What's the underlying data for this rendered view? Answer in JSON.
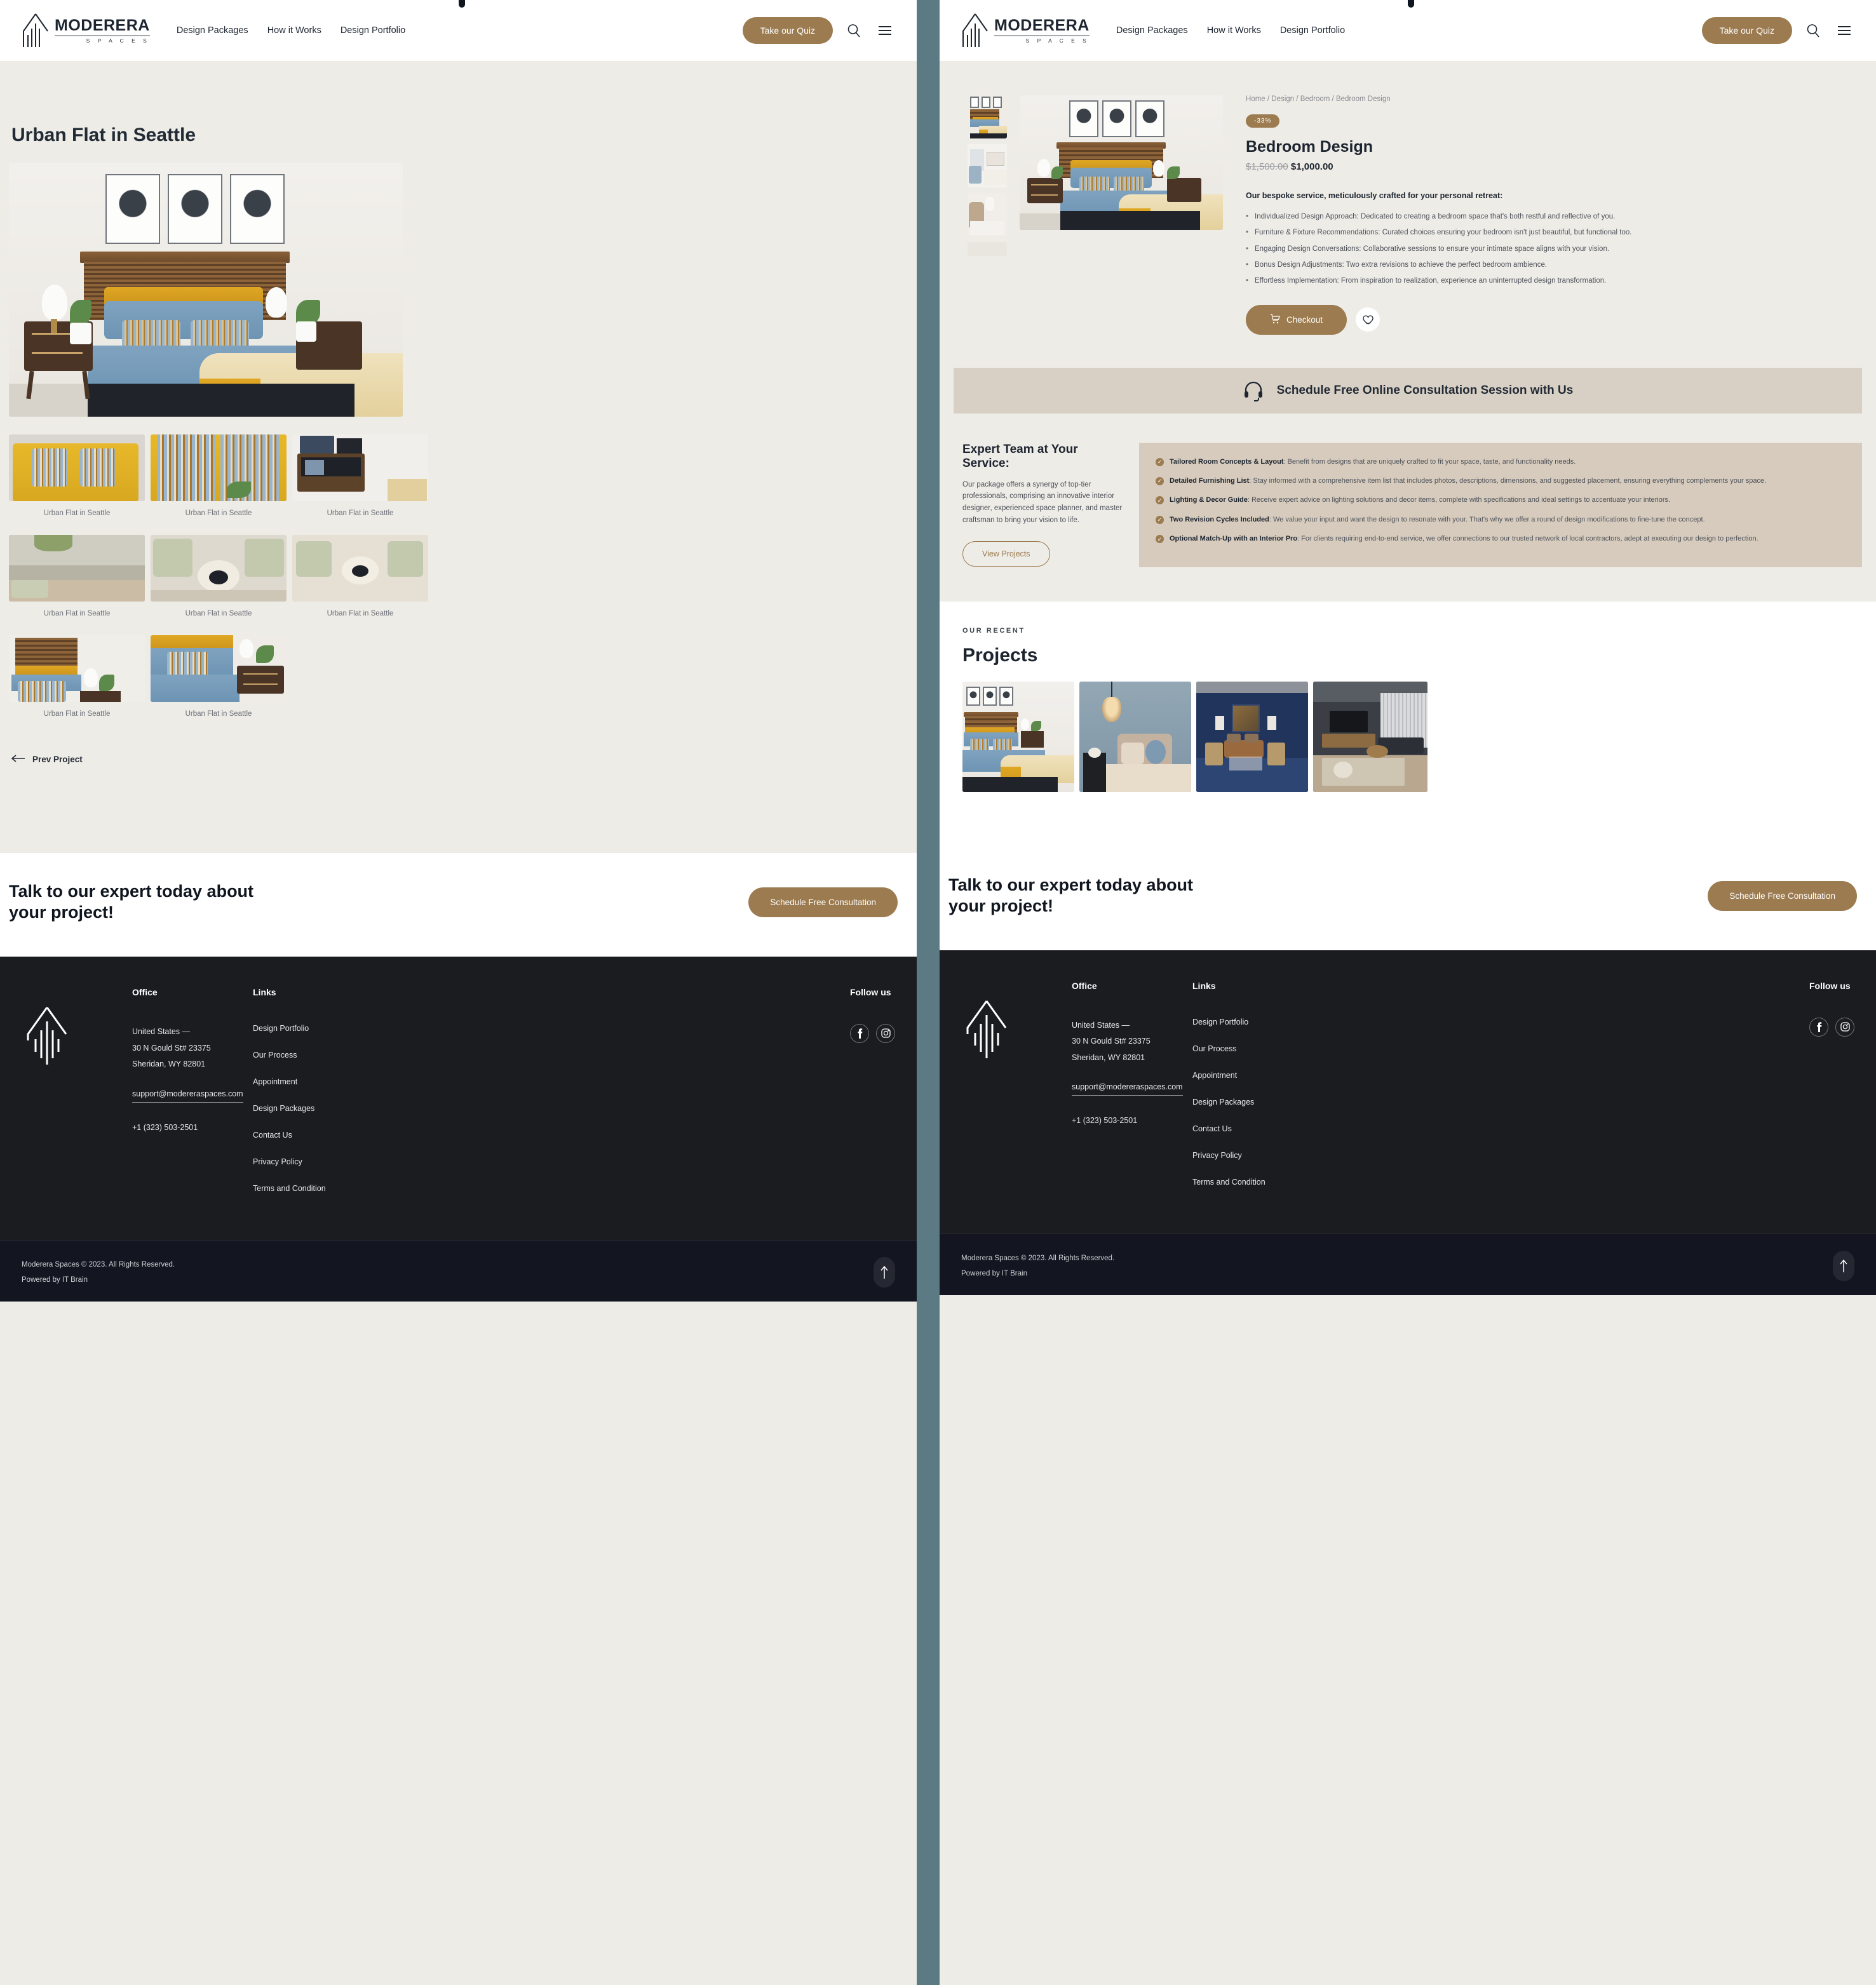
{
  "nav": {
    "brand_name": "MODERERA",
    "brand_sub": "S P A C E S",
    "links": [
      "Design Packages",
      "How it Works",
      "Design Portfolio"
    ],
    "quiz_label": "Take our Quiz",
    "search_icon": "search-icon",
    "menu_icon": "hamburger-menu-icon"
  },
  "left": {
    "project_title": "Urban Flat in Seattle",
    "gallery_caption": "Urban Flat in Seattle",
    "gallery": [
      {
        "caption": "Urban Flat in Seattle"
      },
      {
        "caption": "Urban Flat in Seattle"
      },
      {
        "caption": "Urban Flat in Seattle"
      },
      {
        "caption": "Urban Flat in Seattle"
      },
      {
        "caption": "Urban Flat in Seattle"
      },
      {
        "caption": "Urban Flat in Seattle"
      },
      {
        "caption": "Urban Flat in Seattle"
      },
      {
        "caption": "Urban Flat in Seattle"
      }
    ],
    "prev_label": "Prev Project",
    "prev_icon": "arrow-left-icon"
  },
  "right": {
    "breadcrumb": [
      "Home",
      "Design",
      "Bedroom",
      "Bedroom Design"
    ],
    "discount_badge": "-33%",
    "product_title": "Bedroom Design",
    "price_old": "$1,500.00",
    "price_new": "$1,000.00",
    "desc_heading": "Our bespoke service, meticulously crafted for your personal retreat:",
    "features": [
      "Individualized Design Approach: Dedicated to creating a bedroom space that's both restful and reflective of you.",
      "Furniture & Fixture Recommendations: Curated choices ensuring your bedroom isn't just beautiful, but functional too.",
      "Engaging Design Conversations: Collaborative sessions to ensure your intimate space aligns with your vision.",
      "Bonus Design Adjustments: Two extra revisions to achieve the perfect bedroom ambience.",
      "Effortless Implementation: From inspiration to realization, experience an uninterrupted design transformation."
    ],
    "checkout_label": "Checkout",
    "cart_icon": "shopping-cart-icon",
    "wishlist_icon": "heart-icon",
    "consult_banner": "Schedule Free Online Consultation Session with Us",
    "headset_icon": "headset-icon",
    "expert_heading": "Expert Team at Your Service:",
    "expert_body": "Our package offers a synergy of top-tier professionals, comprising an innovative interior designer, experienced space planner, and master craftsman to bring your vision to life.",
    "view_projects_label": "View Projects",
    "benefits": [
      {
        "title": "Tailored Room Concepts & Layout",
        "text": ": Benefit from designs that are uniquely crafted to fit your space, taste, and functionality needs."
      },
      {
        "title": "Detailed Furnishing List",
        "text": ": Stay informed with a comprehensive item list that includes photos, descriptions, dimensions, and suggested placement, ensuring everything complements your space."
      },
      {
        "title": "Lighting & Decor Guide",
        "text": ": Receive expert advice on lighting solutions and decor items, complete with specifications and ideal settings to accentuate your interiors."
      },
      {
        "title": "Two Revision Cycles Included",
        "text": ": We value your input and want the design to resonate with your. That's why we offer a round of design modifications to fine-tune the concept."
      },
      {
        "title": "Optional Match-Up with an Interior Pro",
        "text": ": For clients requiring end-to-end service, we offer connections to our trusted network of local contractors, adept at executing our design to perfection."
      }
    ],
    "recent_kicker": "OUR RECENT",
    "recent_title": "Projects",
    "check_icon": "check-circle-icon"
  },
  "cta": {
    "heading": "Talk to our expert today about your project!",
    "button": "Schedule Free Consultation"
  },
  "footer": {
    "office_heading": "Office",
    "links_heading": "Links",
    "follow_heading": "Follow us",
    "address_line1": "United States —",
    "address_line2": "30 N Gould St# 23375",
    "address_line3": "Sheridan, WY 82801",
    "email": "support@modereraspaces.com",
    "phone": "+1 (323) 503-2501",
    "links": [
      "Design Portfolio",
      "Our Process",
      "Appointment",
      "Design Packages",
      "Contact Us",
      "Privacy Policy",
      "Terms and Condition"
    ],
    "facebook_icon": "facebook-icon",
    "instagram_icon": "instagram-icon",
    "copyright": "Moderera Spaces © 2023. All Rights Reserved.",
    "powered": "Powered by IT Brain",
    "to_top_icon": "arrow-up-icon"
  },
  "colors": {
    "accent": "#9b7b4f",
    "dark": "#1b1c20",
    "page_bg": "#eeece7",
    "band_bg": "#5b7a84",
    "beige": "#d6cbbd"
  }
}
